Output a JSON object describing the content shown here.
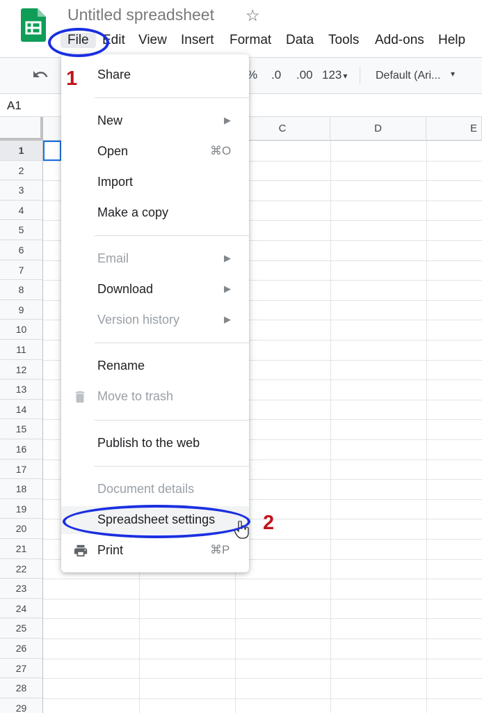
{
  "app": {
    "title": "Untitled spreadsheet",
    "star_icon": "star-outline-icon"
  },
  "menubar": [
    "File",
    "Edit",
    "View",
    "Insert",
    "Format",
    "Data",
    "Tools",
    "Add-ons",
    "Help"
  ],
  "toolbar": {
    "undo_icon": "undo-icon",
    "percent": "%",
    "decimal_decrease": ".0",
    "decimal_increase": ".00",
    "number_format": "123",
    "font": "Default (Ari...",
    "number_format_arrow": "▾",
    "font_arrow": "▾"
  },
  "formula_bar": {
    "cell_ref": "A1"
  },
  "columns": [
    "C",
    "D",
    "E"
  ],
  "rows": [
    "1",
    "2",
    "3",
    "4",
    "5",
    "6",
    "7",
    "8",
    "9",
    "10",
    "11",
    "12",
    "13",
    "14",
    "15",
    "16",
    "17",
    "18",
    "19",
    "20",
    "21",
    "22",
    "23",
    "24",
    "25",
    "26",
    "27",
    "28",
    "29"
  ],
  "file_menu": {
    "share": "Share",
    "new": "New",
    "open": "Open",
    "open_shortcut": "⌘O",
    "import": "Import",
    "make_copy": "Make a copy",
    "email": "Email",
    "download": "Download",
    "version_history": "Version history",
    "rename": "Rename",
    "move_to_trash": "Move to trash",
    "publish": "Publish to the web",
    "document_details": "Document details",
    "spreadsheet_settings": "Spreadsheet settings",
    "print": "Print",
    "print_shortcut": "⌘P",
    "submenu_arrow": "▶"
  },
  "annotations": {
    "step1": "1",
    "step2": "2"
  },
  "colors": {
    "annotation_blue": "#1a2fe0",
    "annotation_red": "#c0141a",
    "sheets_green": "#0f9d58",
    "selection_blue": "#1a73e8"
  }
}
